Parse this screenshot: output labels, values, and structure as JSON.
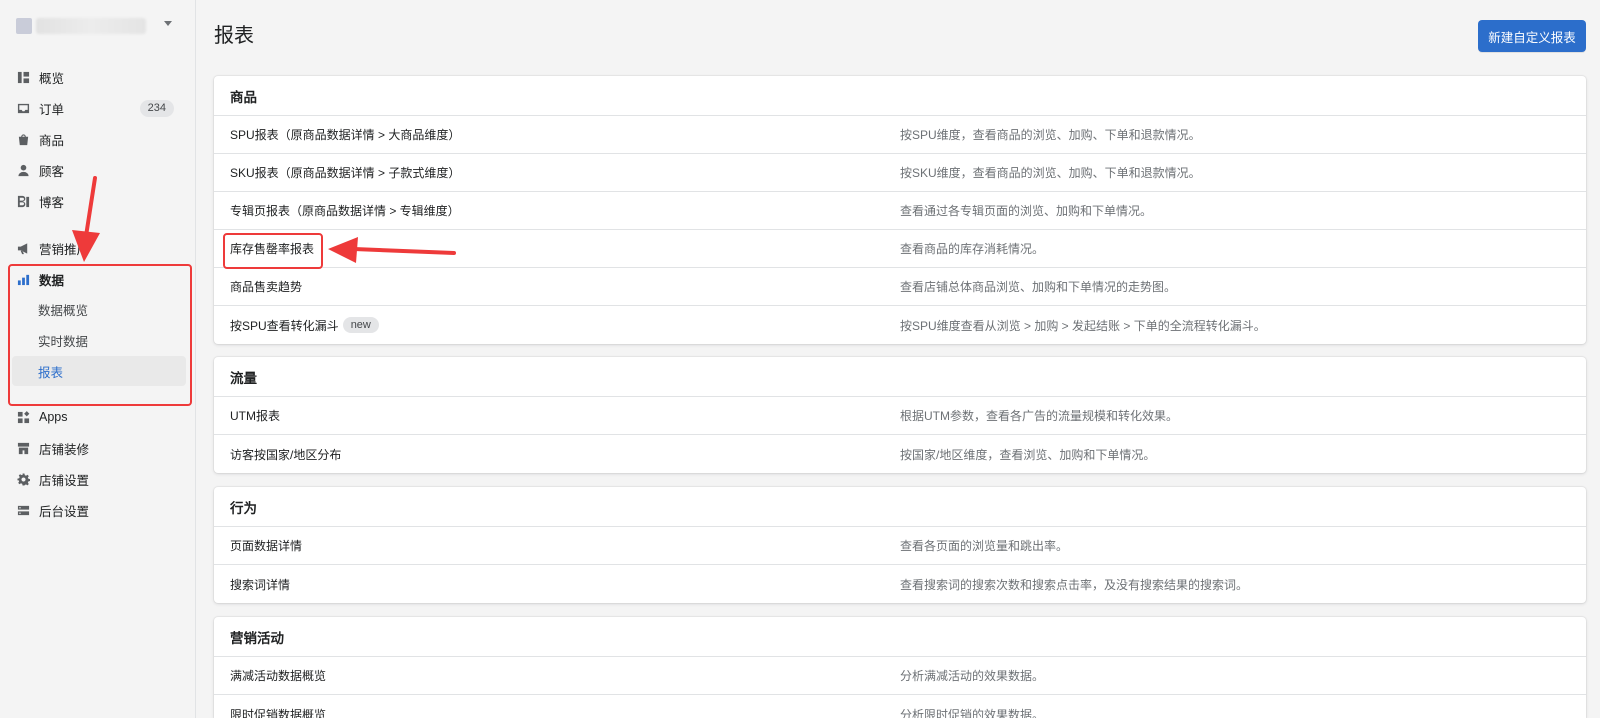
{
  "app": {
    "page_title": "报表",
    "new_report_button": "新建自定义报表"
  },
  "sidebar": {
    "items": [
      {
        "label": "概览",
        "icon": "home-icon"
      },
      {
        "label": "订单",
        "icon": "inbox-icon",
        "badge": "234"
      },
      {
        "label": "商品",
        "icon": "tag-icon"
      },
      {
        "label": "顾客",
        "icon": "person-icon"
      },
      {
        "label": "博客",
        "icon": "blog-icon"
      },
      {
        "label": "营销推广",
        "icon": "megaphone-icon"
      },
      {
        "label": "数据",
        "icon": "bar-chart-icon"
      },
      {
        "label": "Apps",
        "icon": "apps-icon"
      },
      {
        "label": "店铺装修",
        "icon": "store-icon"
      },
      {
        "label": "店铺设置",
        "icon": "gear-icon"
      },
      {
        "label": "后台设置",
        "icon": "server-icon"
      }
    ],
    "data_subitems": [
      {
        "label": "数据概览"
      },
      {
        "label": "实时数据"
      },
      {
        "label": "报表"
      }
    ]
  },
  "sections": [
    {
      "title": "商品",
      "rows": [
        {
          "name": "SPU报表（原商品数据详情 > 大商品维度）",
          "desc": "按SPU维度，查看商品的浏览、加购、下单和退款情况。"
        },
        {
          "name": "SKU报表（原商品数据详情 > 子款式维度）",
          "desc": "按SKU维度，查看商品的浏览、加购、下单和退款情况。"
        },
        {
          "name": "专辑页报表（原商品数据详情 > 专辑维度）",
          "desc": "查看通过各专辑页面的浏览、加购和下单情况。"
        },
        {
          "name": "库存售罄率报表",
          "desc": "查看商品的库存消耗情况。"
        },
        {
          "name": "商品售卖趋势",
          "desc": "查看店铺总体商品浏览、加购和下单情况的走势图。"
        },
        {
          "name": "按SPU查看转化漏斗",
          "tag": "new",
          "desc": "按SPU维度查看从浏览 > 加购 > 发起结账 > 下单的全流程转化漏斗。"
        }
      ]
    },
    {
      "title": "流量",
      "rows": [
        {
          "name": "UTM报表",
          "desc": "根据UTM参数，查看各广告的流量规模和转化效果。"
        },
        {
          "name": "访客按国家/地区分布",
          "desc": "按国家/地区维度，查看浏览、加购和下单情况。"
        }
      ]
    },
    {
      "title": "行为",
      "rows": [
        {
          "name": "页面数据详情",
          "desc": "查看各页面的浏览量和跳出率。"
        },
        {
          "name": "搜索词详情",
          "desc": "查看搜索词的搜索次数和搜索点击率，及没有搜索结果的搜索词。"
        }
      ]
    },
    {
      "title": "营销活动",
      "rows": [
        {
          "name": "满减活动数据概览",
          "desc": "分析满减活动的效果数据。"
        },
        {
          "name": "限时促销数据概览",
          "desc": "分析限时促销的效果数据。"
        }
      ]
    }
  ],
  "colors": {
    "accent": "#2c6ecb",
    "annotation": "#ee3a3a"
  }
}
